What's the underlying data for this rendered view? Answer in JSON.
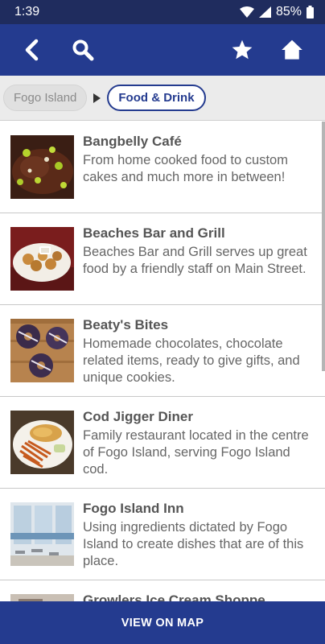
{
  "status_bar": {
    "time": "1:39",
    "battery": "85%"
  },
  "app_bar": {
    "back_icon": "back-arrow-icon",
    "search_icon": "search-icon",
    "favorite_icon": "star-icon",
    "home_icon": "home-icon"
  },
  "breadcrumbs": [
    {
      "label": "Fogo Island"
    },
    {
      "label": "Food & Drink"
    }
  ],
  "items": [
    {
      "title": "Bangbelly Café",
      "description": "From home cooked food to custom cakes and much more in between!"
    },
    {
      "title": "Beaches Bar and Grill",
      "description": "Beaches Bar and Grill serves up great food by a friendly staff on Main Street."
    },
    {
      "title": "Beaty's Bites",
      "description": "Homemade chocolates, chocolate related items, ready to give gifts, and unique cookies."
    },
    {
      "title": "Cod Jigger Diner",
      "description": "Family restaurant located in the centre of Fogo Island, serving Fogo Island cod."
    },
    {
      "title": "Fogo Island Inn",
      "description": "Using ingredients dictated by Fogo Island to create dishes that are of this place."
    },
    {
      "title": "Growlers Ice Cream Shoppe",
      "description": ""
    }
  ],
  "map_button": {
    "label": "VIEW ON MAP"
  },
  "colors": {
    "primary": "#243b8f",
    "status": "#1f2c5e"
  }
}
